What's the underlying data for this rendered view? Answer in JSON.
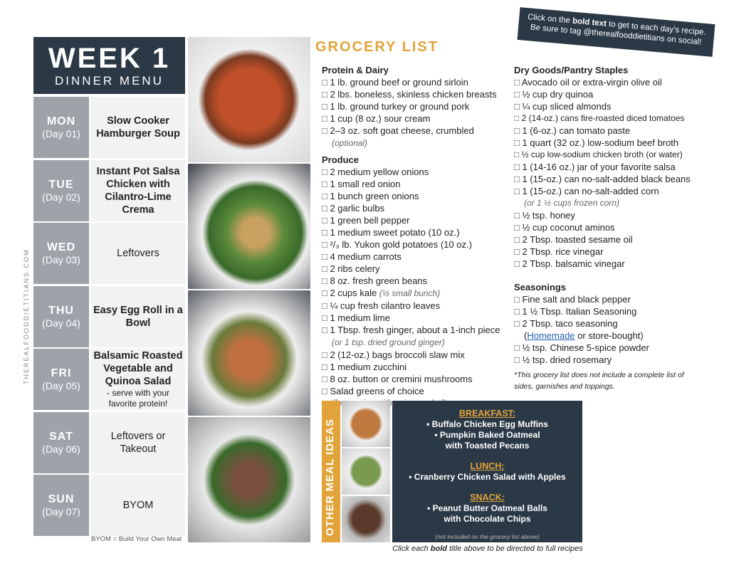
{
  "banner": {
    "line1_pre": "Click on the ",
    "line1_bold": "bold text",
    "line1_post": " to get to each day's recipe.",
    "line2": "Be sure to tag @therealfooddietitians on social!"
  },
  "header": {
    "week": "WEEK 1",
    "subtitle": "DINNER MENU"
  },
  "watermark": "THEREALFOODDIETITIANS.COM",
  "days": [
    {
      "name": "MON",
      "day": "(Day 01)",
      "meal": "Slow Cooker Hamburger Soup",
      "bold": true,
      "note": ""
    },
    {
      "name": "TUE",
      "day": "(Day 02)",
      "meal": "Instant Pot Salsa Chicken with Cilantro-Lime Crema",
      "bold": true,
      "note": ""
    },
    {
      "name": "WED",
      "day": "(Day 03)",
      "meal": "Leftovers",
      "bold": false,
      "note": ""
    },
    {
      "name": "THU",
      "day": "(Day 04)",
      "meal": "Easy Egg Roll in a Bowl",
      "bold": true,
      "note": ""
    },
    {
      "name": "FRI",
      "day": "(Day 05)",
      "meal": "Balsamic Roasted Vegetable and Quinoa Salad",
      "bold": true,
      "note": "- serve with your favorite protein!"
    },
    {
      "name": "SAT",
      "day": "(Day 06)",
      "meal": "Leftovers or Takeout",
      "bold": false,
      "note": ""
    },
    {
      "name": "SUN",
      "day": "(Day 07)",
      "meal": "BYOM",
      "bold": false,
      "note": ""
    }
  ],
  "byom_note": "BYOM = Build Your Own Meal",
  "grocery": {
    "title": "GROCERY LIST",
    "protein": {
      "title": "Protein & Dairy",
      "items": [
        "1 lb. ground beef or ground sirloin",
        "2 lbs. boneless, skinless chicken breasts",
        "1 lb. ground turkey or ground pork",
        "1 cup (8 oz.) sour cream",
        "2–3 oz. soft goat cheese, crumbled"
      ],
      "last_note": "(optional)"
    },
    "produce": {
      "title": "Produce",
      "items": [
        "2 medium yellow onions",
        "1 small red onion",
        "1 bunch green onions",
        "2 garlic bulbs",
        "1 green bell pepper",
        "1 medium sweet potato (10 oz.)",
        "²/₃ lb. Yukon gold potatoes (10 oz.)",
        "4 medium carrots",
        "2 ribs celery",
        "8 oz. fresh green beans",
        "2 cups kale",
        "¼ cup fresh cilantro leaves",
        "1 medium lime",
        "1 Tbsp. fresh ginger, about a 1-inch piece",
        "2 (12-oz.) bags broccoli slaw mix",
        "1 medium zucchini",
        "8 oz. button or cremini mushrooms",
        "Salad greens of choice"
      ],
      "kale_note": "(½ small bunch)",
      "ginger_note": "(or 1 tsp. dried ground ginger)",
      "greens_note": "(for serving with quinoa salad)"
    },
    "dry": {
      "title": "Dry Goods/Pantry Staples",
      "items": [
        "Avocado oil or extra-virgin olive oil",
        "½ cup dry quinoa",
        "¼ cup sliced almonds",
        "2 (14-oz.) cans fire-roasted diced tomatoes",
        "1 (6-oz.) can tomato paste",
        "1 quart (32 oz.) low-sodium beef broth",
        "½ cup  low-sodium chicken broth (or water)",
        "1 (14-16 oz.) jar of your favorite salsa",
        "1 (15-oz.) can no-salt-added black beans",
        "1 (15-oz.) can no-salt-added corn",
        "½ tsp. honey",
        "½ cup coconut aminos",
        "2 Tbsp. toasted sesame oil",
        "2 Tbsp. rice vinegar",
        "2 Tbsp. balsamic vinegar"
      ],
      "corn_note": "(or 1 ½ cups frozen corn)"
    },
    "seasonings": {
      "title": "Seasonings",
      "items": [
        "Fine salt and black pepper",
        "1 ½ Tbsp. Italian Seasoning",
        "2 Tbsp. taco seasoning",
        "½ tsp. Chinese 5-spice powder",
        "½ tsp. dried rosemary"
      ],
      "taco_link": "Homemade",
      "taco_rest": " or store-bought)",
      "taco_open": "("
    },
    "footnote": "*This grocery list does not include a complete list of sides, garnishes and toppings."
  },
  "ideas": {
    "label": "OTHER MEAL IDEAS",
    "breakfast": "BREAKFAST:",
    "b1": "• Buffalo Chicken Egg Muffins",
    "b2": "• Pumpkin Baked Oatmeal",
    "b3": "with Toasted Pecans",
    "lunch": "LUNCH:",
    "l1": "• Cranberry Chicken Salad with Apples",
    "snack": "SNACK:",
    "s1": "• Peanut Butter Oatmeal Balls",
    "s2": "with Chocolate Chips",
    "note": "(not included on the grocery list above)"
  },
  "click_pre": "Click each ",
  "click_bold": "bold",
  "click_post": " title above to be directed to full recipes",
  "colors": {
    "navy": "#2b3947",
    "orange": "#e2a43a",
    "gray": "#9ea3aa",
    "link": "#2a5db0"
  }
}
